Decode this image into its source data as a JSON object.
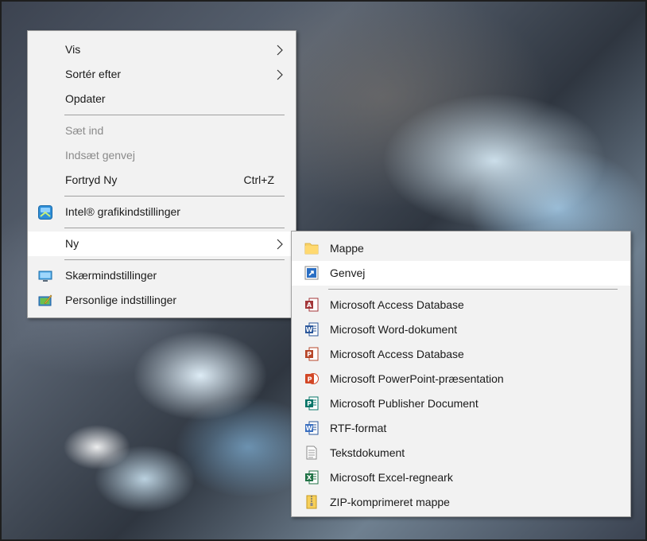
{
  "context_menu": {
    "items": [
      {
        "label": "Vis"
      },
      {
        "label": "Sortér efter"
      },
      {
        "label": "Opdater"
      },
      {
        "label": "Sæt ind"
      },
      {
        "label": "Indsæt genvej"
      },
      {
        "label": "Fortryd Ny",
        "shortcut": "Ctrl+Z"
      },
      {
        "label": "Intel® grafikindstillinger",
        "icon": "intel-graphics-icon"
      },
      {
        "label": "Ny"
      },
      {
        "label": "Skærmindstillinger",
        "icon": "display-settings-icon"
      },
      {
        "label": "Personlige indstillinger",
        "icon": "personalize-icon"
      }
    ]
  },
  "new_submenu": {
    "items": [
      {
        "label": "Mappe",
        "icon": "folder-icon"
      },
      {
        "label": "Genvej",
        "icon": "shortcut-icon"
      },
      {
        "label": "Microsoft Access Database",
        "icon": "access-icon"
      },
      {
        "label": "Microsoft Word-dokument",
        "icon": "word-icon"
      },
      {
        "label": "Microsoft Access Database",
        "icon": "access-icon"
      },
      {
        "label": "Microsoft PowerPoint-præsentation",
        "icon": "powerpoint-icon"
      },
      {
        "label": "Microsoft Publisher Document",
        "icon": "publisher-icon"
      },
      {
        "label": "RTF-format",
        "icon": "rtf-icon"
      },
      {
        "label": "Tekstdokument",
        "icon": "text-document-icon"
      },
      {
        "label": "Microsoft Excel-regneark",
        "icon": "excel-icon"
      },
      {
        "label": "ZIP-komprimeret mappe",
        "icon": "zip-folder-icon"
      }
    ]
  },
  "colors": {
    "menu_bg": "#f2f2f2",
    "hover_bg": "#ffffff",
    "disabled_text": "#8a8a8a"
  }
}
